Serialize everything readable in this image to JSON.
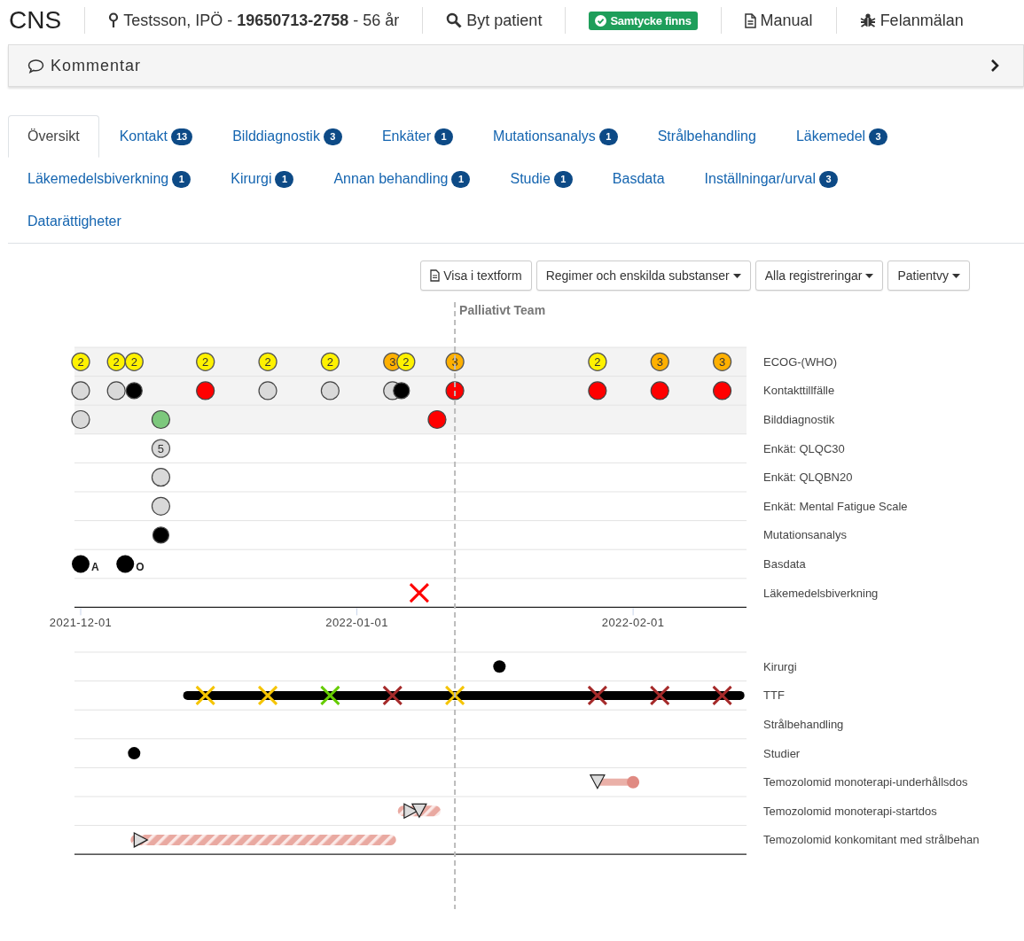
{
  "header": {
    "logo": "CNS",
    "patient": "Testsson, IPÖ - **19650713-2758** - 56 år",
    "search_link": "Byt patient",
    "consent_badge": "Samtycke finns",
    "manual_link": "Manual",
    "report_link": "Felanmälan"
  },
  "comment_bar": {
    "label": "Kommentar",
    "expanded": false
  },
  "tabs": [
    {
      "label": "Översikt",
      "selected": true
    },
    {
      "label": "Kontakt",
      "count": "13",
      "selected": false
    },
    {
      "label": "Bilddiagnostik",
      "count": "3",
      "selected": false
    },
    {
      "label": "Enkäter",
      "count": "1",
      "selected": false
    },
    {
      "label": "Mutationsanalys",
      "count": "1",
      "selected": false
    },
    {
      "label": "Strålbehandling",
      "selected": false
    },
    {
      "label": "Läkemedel",
      "count": "3",
      "selected": false
    },
    {
      "label": "Läkemedelsbiverkning",
      "count": "1",
      "selected": false
    },
    {
      "label": "Kirurgi",
      "count": "1",
      "selected": false
    },
    {
      "label": "Annan behandling",
      "count": "1",
      "selected": false
    },
    {
      "label": "Studie",
      "count": "1",
      "selected": false
    },
    {
      "label": "Basdata",
      "selected": false
    },
    {
      "label": "Inställningar/urval",
      "count": "3",
      "selected": false
    },
    {
      "label": "Datarättigheter",
      "selected": false
    }
  ],
  "toolbar": [
    {
      "label": "Visa i textform",
      "kind": "text-view"
    },
    {
      "label": "Regimer och enskilda substanser",
      "kind": "dropdown"
    },
    {
      "label": "Alla registreringar",
      "kind": "dropdown"
    },
    {
      "label": "Patientvy",
      "kind": "dropdown"
    }
  ],
  "timeline": {
    "marker_line": {
      "label": "Palliativt Team"
    },
    "axis_ticks": [
      "2021-12-01",
      "2022-01-01",
      "2022-02-01"
    ],
    "upper_rows": [
      {
        "label": "ECOG-(WHO)",
        "shaded": true,
        "events": [
          {
            "kind": "badge",
            "label": "2",
            "color": "#fff200"
          },
          {
            "kind": "badge",
            "label": "2",
            "color": "#fff200"
          },
          {
            "kind": "badge",
            "label": "2",
            "color": "#fff200"
          },
          {
            "kind": "badge",
            "label": "2",
            "color": "#fff200"
          },
          {
            "kind": "badge",
            "label": "2",
            "color": "#fff200"
          },
          {
            "kind": "badge",
            "label": "2",
            "color": "#fff200"
          },
          {
            "kind": "badge",
            "label": "3",
            "color": "#ffb000"
          },
          {
            "kind": "badge",
            "label": "2",
            "color": "#fff200"
          },
          {
            "kind": "badge",
            "label": "3",
            "color": "#ffb000"
          },
          {
            "kind": "badge",
            "label": "2",
            "color": "#fff200"
          },
          {
            "kind": "badge",
            "label": "3",
            "color": "#ffb000"
          },
          {
            "kind": "badge",
            "label": "3",
            "color": "#ffb000"
          }
        ]
      },
      {
        "label": "Kontakttillfälle",
        "shaded": true,
        "events": [
          {
            "kind": "circle",
            "color": "#d9d9d9"
          },
          {
            "kind": "circle",
            "color": "#d9d9d9"
          },
          {
            "kind": "circle",
            "color": "#000000"
          },
          {
            "kind": "circle",
            "color": "#ff0000"
          },
          {
            "kind": "circle",
            "color": "#d9d9d9"
          },
          {
            "kind": "circle",
            "color": "#d9d9d9"
          },
          {
            "kind": "circle",
            "color": "#d9d9d9"
          },
          {
            "kind": "circle",
            "color": "#000000"
          },
          {
            "kind": "circle",
            "color": "#ff0000"
          },
          {
            "kind": "circle",
            "color": "#ff0000"
          },
          {
            "kind": "circle",
            "color": "#ff0000"
          },
          {
            "kind": "circle",
            "color": "#ff0000"
          }
        ]
      },
      {
        "label": "Bilddiagnostik",
        "shaded": true,
        "events": [
          {
            "kind": "circle",
            "color": "#d9d9d9"
          },
          {
            "kind": "circle",
            "color": "#7dc87d"
          },
          {
            "kind": "circle",
            "color": "#ff0000"
          }
        ]
      },
      {
        "label": "Enkät: QLQC30",
        "shaded": false,
        "events": [
          {
            "kind": "badge",
            "label": "5",
            "color": "#d9d9d9"
          }
        ]
      },
      {
        "label": "Enkät: QLQBN20",
        "shaded": false,
        "events": [
          {
            "kind": "circle",
            "color": "#d9d9d9"
          }
        ]
      },
      {
        "label": "Enkät: Mental Fatigue Scale",
        "shaded": false,
        "events": [
          {
            "kind": "circle",
            "color": "#d9d9d9"
          }
        ]
      },
      {
        "label": "Mutationsanalys",
        "shaded": false,
        "events": [
          {
            "kind": "circle",
            "color": "#000000"
          }
        ]
      },
      {
        "label": "Basdata",
        "shaded": false,
        "events": [
          {
            "kind": "dot",
            "label": "A"
          },
          {
            "kind": "dot",
            "label": "O"
          }
        ]
      },
      {
        "label": "Läkemedelsbiverkning",
        "shaded": false,
        "events": [
          {
            "kind": "cross",
            "color": "#ff0000"
          }
        ]
      }
    ],
    "lower_rows": [
      {
        "label": "Kirurgi",
        "events": [
          {
            "kind": "small-dot"
          }
        ]
      },
      {
        "label": "TTF",
        "events": [
          {
            "kind": "thick-bar"
          },
          {
            "kind": "cross",
            "color": "#f5c400"
          },
          {
            "kind": "cross",
            "color": "#f5c400"
          },
          {
            "kind": "cross",
            "color": "#66cc00"
          },
          {
            "kind": "cross",
            "color": "#a52a2a"
          },
          {
            "kind": "cross",
            "color": "#f5c400"
          },
          {
            "kind": "cross",
            "color": "#a52a2a"
          },
          {
            "kind": "cross",
            "color": "#a52a2a"
          },
          {
            "kind": "cross",
            "color": "#a52a2a"
          }
        ]
      },
      {
        "label": "Strålbehandling"
      },
      {
        "label": "Studier",
        "events": [
          {
            "kind": "small-dot"
          }
        ]
      },
      {
        "label": "Temozolomid monoterapi-underhållsdos",
        "events": [
          {
            "kind": "bar"
          },
          {
            "kind": "triangle-down"
          }
        ]
      },
      {
        "label": "Temozolomid monoterapi-startdos",
        "events": [
          {
            "kind": "hatched-bar"
          },
          {
            "kind": "triangle-right"
          },
          {
            "kind": "triangle-down"
          }
        ]
      },
      {
        "label": "Temozolomid konkomitant med strålbehan",
        "events": [
          {
            "kind": "hatched-bar"
          },
          {
            "kind": "triangle-right"
          }
        ]
      }
    ]
  }
}
